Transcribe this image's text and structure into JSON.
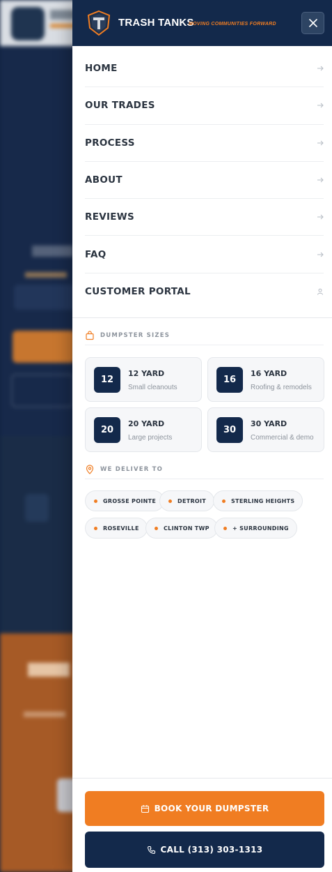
{
  "brand": {
    "name": "TRASH TANKS",
    "tagline": "MOVING COMMUNITIES FORWARD"
  },
  "colors": {
    "navy": "#13294b",
    "orange": "#f07d22",
    "text": "#2b3440",
    "muted": "#8c939c"
  },
  "nav": {
    "items": [
      {
        "label": "HOME",
        "icon": "arrow-right-icon"
      },
      {
        "label": "OUR TRADES",
        "icon": "arrow-right-icon"
      },
      {
        "label": "PROCESS",
        "icon": "arrow-right-icon"
      },
      {
        "label": "ABOUT",
        "icon": "arrow-right-icon"
      },
      {
        "label": "REVIEWS",
        "icon": "arrow-right-icon"
      },
      {
        "label": "FAQ",
        "icon": "arrow-right-icon"
      },
      {
        "label": "CUSTOMER PORTAL",
        "icon": "user-icon"
      }
    ]
  },
  "sizes": {
    "heading": "DUMPSTER SIZES",
    "items": [
      {
        "number": "12",
        "title": "12 YARD",
        "subtitle": "Small cleanouts"
      },
      {
        "number": "16",
        "title": "16 YARD",
        "subtitle": "Roofing & remodels"
      },
      {
        "number": "20",
        "title": "20 YARD",
        "subtitle": "Large projects"
      },
      {
        "number": "30",
        "title": "30 YARD",
        "subtitle": "Commercial & demo"
      }
    ]
  },
  "delivery": {
    "heading": "WE DELIVER TO",
    "areas": [
      "GROSSE POINTE",
      "DETROIT",
      "STERLING HEIGHTS",
      "ROSEVILLE",
      "CLINTON TWP",
      "+ SURROUNDING"
    ]
  },
  "cta": {
    "book_label": "BOOK YOUR DUMPSTER",
    "call_label": "CALL (313) 303-1313"
  }
}
